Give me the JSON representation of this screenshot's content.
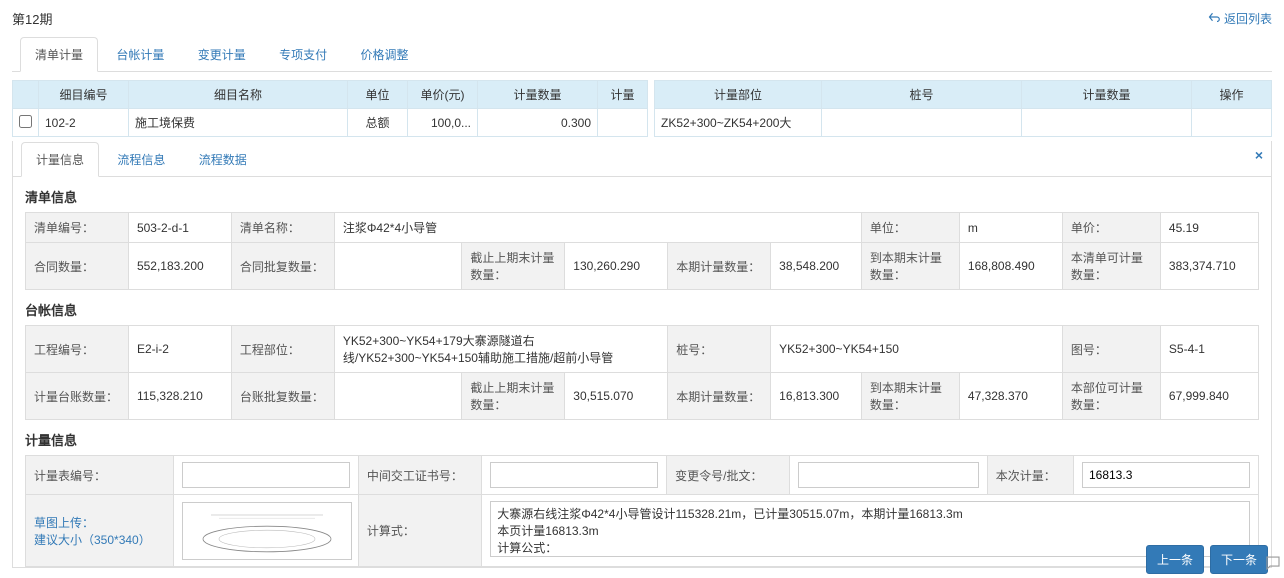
{
  "header": {
    "title": "第12期",
    "back_label": "返回列表"
  },
  "top_tabs": {
    "items": [
      {
        "label": "清单计量",
        "active": true
      },
      {
        "label": "台帐计量",
        "active": false
      },
      {
        "label": "变更计量",
        "active": false
      },
      {
        "label": "专项支付",
        "active": false
      },
      {
        "label": "价格调整",
        "active": false
      }
    ]
  },
  "left_grid": {
    "headers": [
      "",
      "细目编号",
      "细目名称",
      "单位",
      "单价(元)",
      "计量数量",
      "计量"
    ],
    "row": {
      "code": "102-2",
      "name": "施工境保费",
      "unit": "总额",
      "price": "100,0...",
      "qty": "0.300",
      "calc": ""
    }
  },
  "right_grid": {
    "headers": [
      "计量部位",
      "桩号",
      "计量数量",
      "操作"
    ],
    "row": {
      "part": "ZK52+300~ZK54+200大",
      "stake": "",
      "qty": "",
      "ops": ""
    }
  },
  "detail_tabs": {
    "items": [
      {
        "label": "计量信息",
        "active": true
      },
      {
        "label": "流程信息",
        "active": false
      },
      {
        "label": "流程数据",
        "active": false
      }
    ]
  },
  "sections": {
    "qd_title": "清单信息",
    "tz_title": "台帐信息",
    "jl_title": "计量信息"
  },
  "qd": {
    "code_lbl": "清单编号：",
    "code": "503-2-d-1",
    "name_lbl": "清单名称：",
    "name": "注浆Φ42*4小导管",
    "unit_lbl": "单位：",
    "unit": "m",
    "price_lbl": "单价：",
    "price": "45.19",
    "contract_qty_lbl": "合同数量：",
    "contract_qty": "552,183.200",
    "approved_lbl": "合同批复数量：",
    "approved": "",
    "prev_end_lbl": "截止上期末计量数量：",
    "prev_end": "130,260.290",
    "this_qty_lbl": "本期计量数量：",
    "this_qty": "38,548.200",
    "to_end_lbl": "到本期末计量数量：",
    "to_end": "168,808.490",
    "can_lbl": "本清单可计量数量：",
    "can": "383,374.710"
  },
  "tz": {
    "proj_code_lbl": "工程编号：",
    "proj_code": "E2-i-2",
    "proj_part_lbl": "工程部位：",
    "proj_part": "YK52+300~YK54+179大寨源隧道右线/YK52+300~YK54+150辅助施工措施/超前小导管",
    "stake_lbl": "桩号：",
    "stake": "YK52+300~YK54+150",
    "drawing_lbl": "图号：",
    "drawing": "S5-4-1",
    "ledger_qty_lbl": "计量台账数量：",
    "ledger_qty": "115,328.210",
    "ledger_approved_lbl": "台账批复数量：",
    "ledger_approved": "",
    "prev_end_lbl": "截止上期末计量数量：",
    "prev_end": "30,515.070",
    "this_qty_lbl": "本期计量数量：",
    "this_qty": "16,813.300",
    "to_end_lbl": "到本期末计量数量：",
    "to_end": "47,328.370",
    "can_lbl": "本部位可计量数量：",
    "can": "67,999.840"
  },
  "jl": {
    "table_code_lbl": "计量表编号：",
    "table_code": "",
    "mid_cert_lbl": "中间交工证书号：",
    "mid_cert": "",
    "change_no_lbl": "变更令号/批文：",
    "change_no": "",
    "this_qty_lbl": "本次计量：",
    "this_qty": "16813.3",
    "upload_link": "草图上传：",
    "upload_hint": "建议大小（350*340）",
    "formula_lbl": "计算式：",
    "formula": "大寨源右线注浆Φ42*4小导管设计115328.21m，已计量30515.07m，本期计量16813.3m\n本页计量16813.3m\n计算公式："
  },
  "footer": {
    "prev": "上一条",
    "next": "下一条"
  }
}
